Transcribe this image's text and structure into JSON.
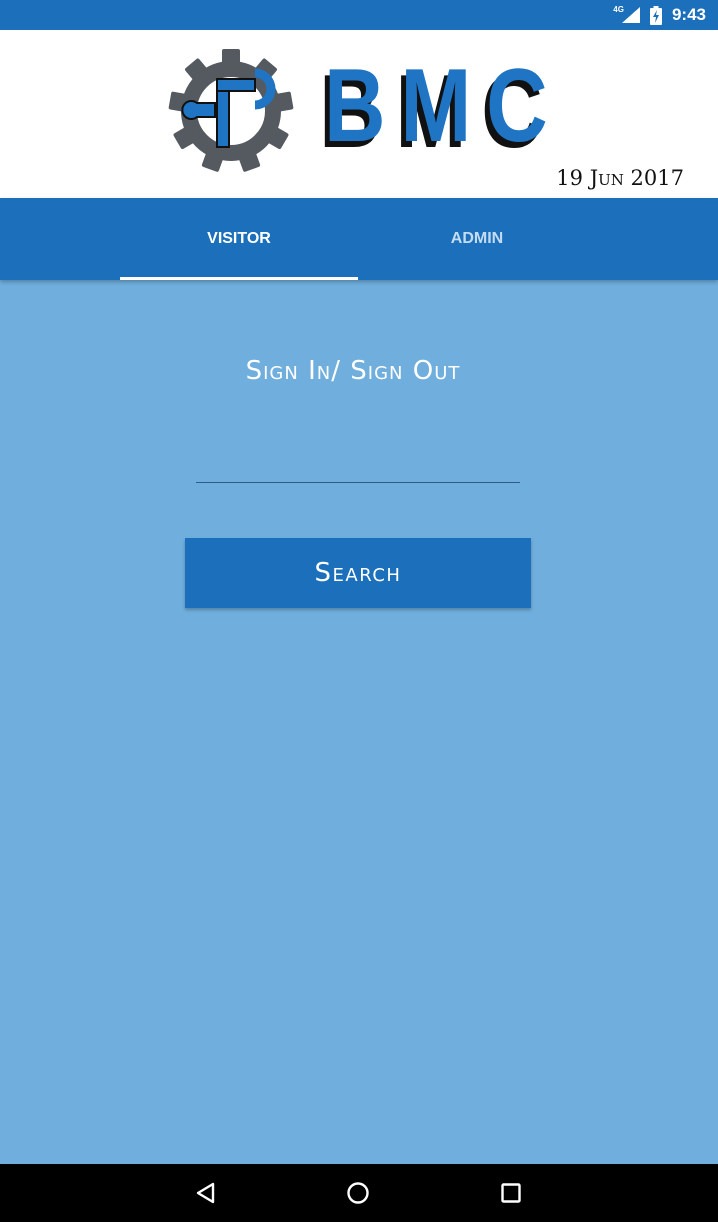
{
  "status_bar": {
    "network_label": "4G",
    "time": "9:43",
    "icons": [
      "signal-icon",
      "battery-charging-icon"
    ]
  },
  "header": {
    "brand": "BMC",
    "logo_icon": "gear-wrench-icon",
    "date": "19 Jun 2017"
  },
  "tabs": {
    "items": [
      {
        "label": "VISITOR",
        "active": true
      },
      {
        "label": "ADMIN",
        "active": false
      }
    ]
  },
  "main": {
    "title": "Sign In/ Sign Out",
    "search_value": "",
    "search_button_label": "Search"
  },
  "nav_bar": {
    "icons": [
      "back-icon",
      "home-icon",
      "recents-icon"
    ]
  },
  "colors": {
    "primary": "#1c6fbb",
    "background": "#6faedd",
    "brand_blue": "#1f74c4",
    "gear_gray": "#555a60"
  }
}
